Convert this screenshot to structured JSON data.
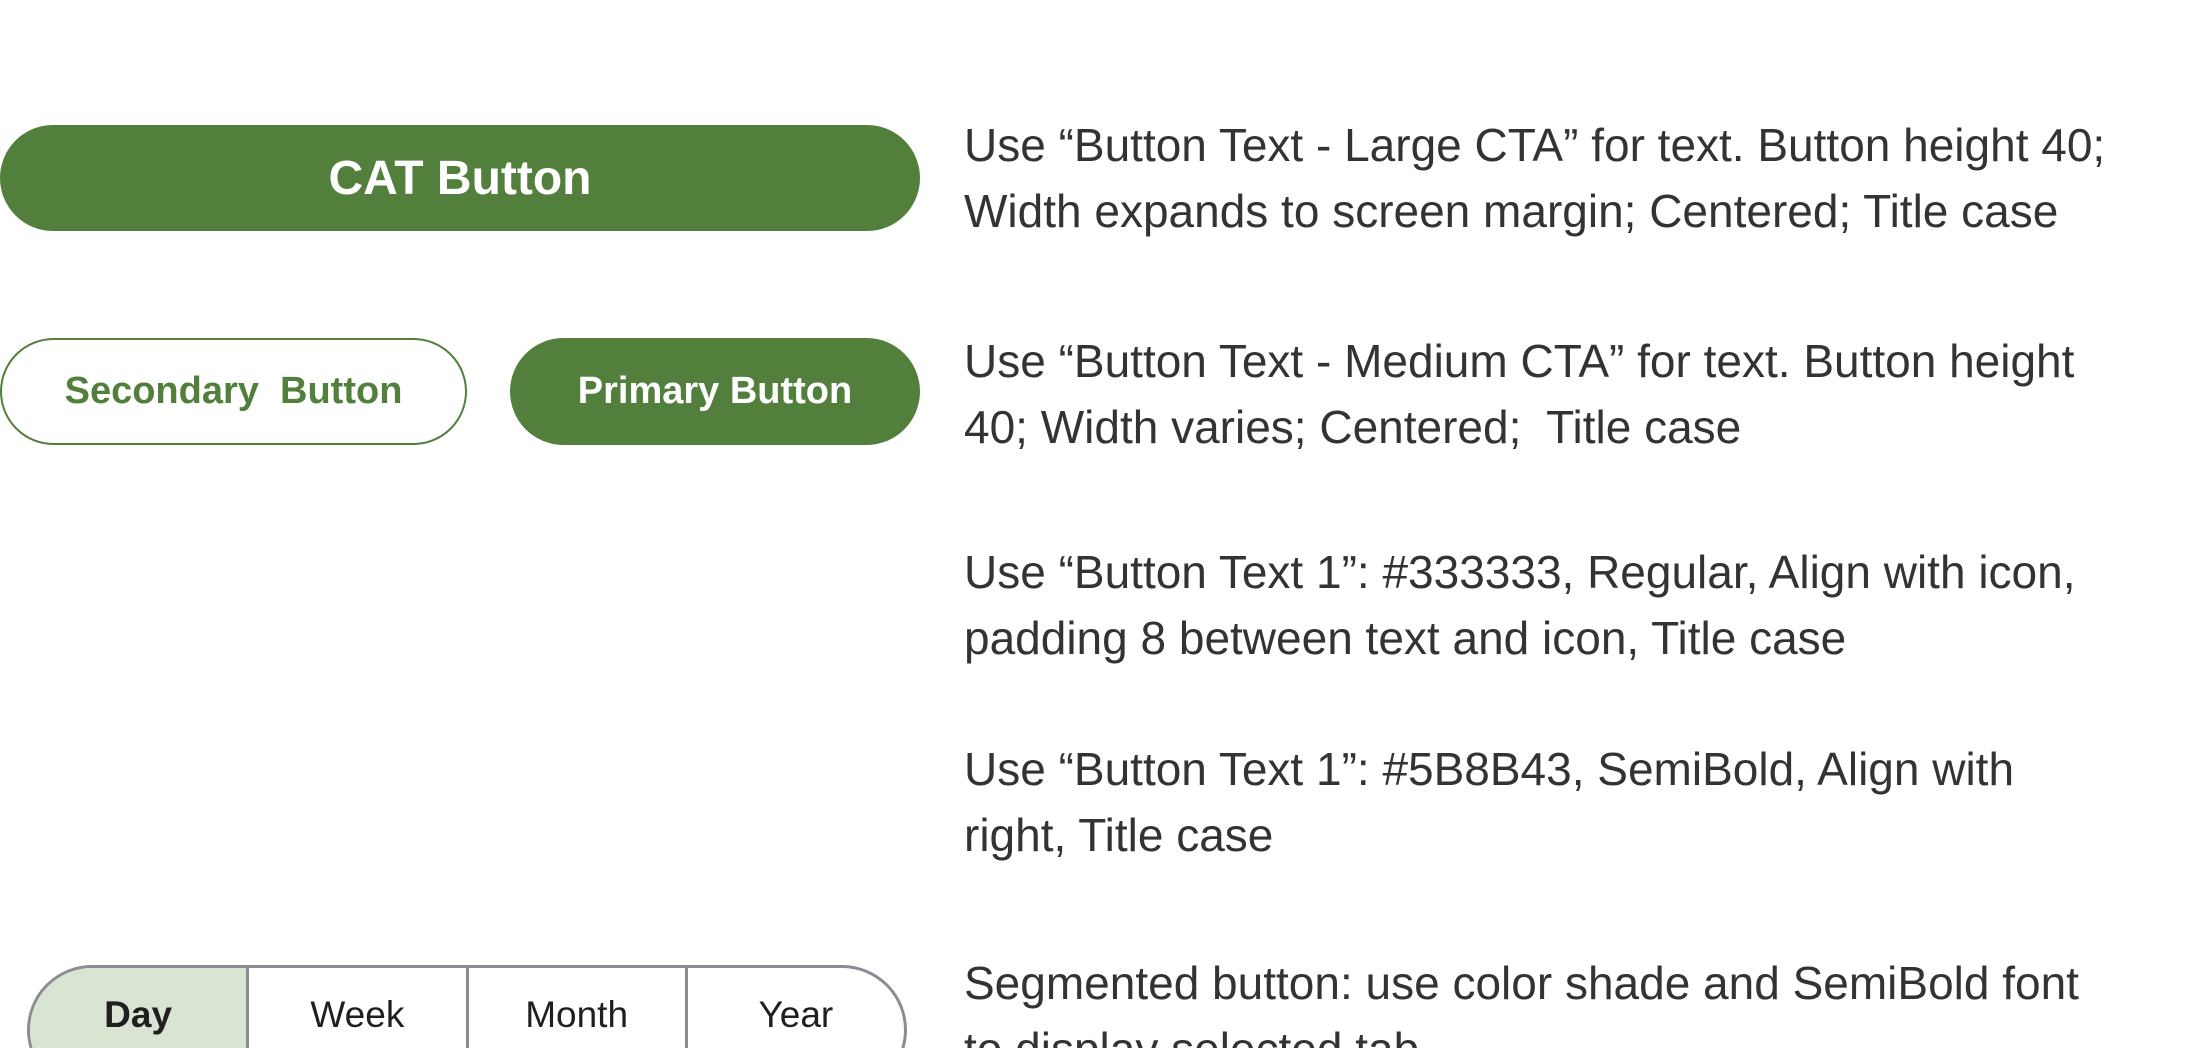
{
  "buttons": {
    "cta_label": "CAT Button",
    "secondary_label": "Secondary  Button",
    "primary_label": "Primary Button"
  },
  "descriptions": {
    "large_cta": {
      "line1": "Use “Button Text - Large CTA” for text. Button height 40;",
      "line2": "Width expands to screen margin; Centered; Title case"
    },
    "medium_cta": {
      "line1": "Use “Button Text - Medium CTA” for text. Button height",
      "line2": "40; Width varies; Centered;  Title case"
    },
    "text_regular": {
      "line1": "Use “Button Text 1”: #333333, Regular, Align with icon,",
      "line2": "padding 8 between text and icon, Title case"
    },
    "text_semibold": {
      "line1": "Use “Button Text 1”: #5B8B43, SemiBold, Align with",
      "line2": "right, Title case"
    },
    "segmented": {
      "line1": "Segmented button: use color shade and SemiBold font",
      "line2": "to display selected tab"
    }
  },
  "segmented_control": {
    "selected": "Day",
    "tabs": [
      "Day",
      "Week",
      "Month",
      "Year"
    ]
  },
  "colors": {
    "brand_green": "#537f3c",
    "selected_tab_shade": "#d8e5d3",
    "text_dark": "#333333",
    "segment_border": "#8b8b94"
  }
}
